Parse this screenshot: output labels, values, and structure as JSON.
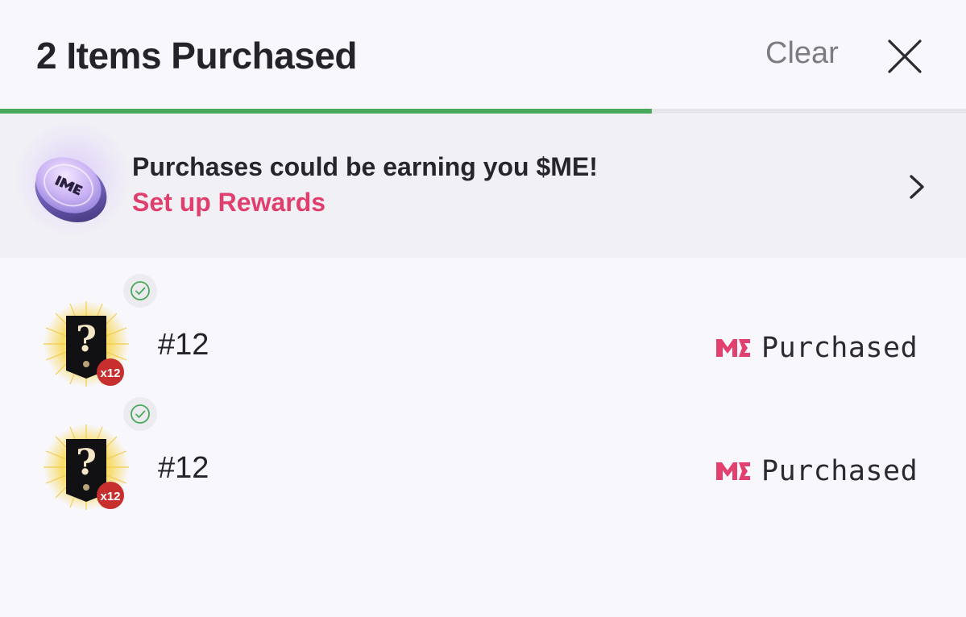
{
  "header": {
    "title": "2 Items Purchased",
    "clear_label": "Clear",
    "close_icon": "close-icon"
  },
  "progress": {
    "fraction": 0.675,
    "color": "#4aa85a"
  },
  "rewards": {
    "coin_icon": "me-coin-icon",
    "text": "Purchases could be earning you $ME!",
    "link": "Set up Rewards",
    "link_color": "#e03f6e",
    "chevron_icon": "chevron-right-icon"
  },
  "items": [
    {
      "name": "#12",
      "badge": "x12",
      "status": "Purchased",
      "check_icon": "check-circle-icon",
      "status_icon": "magic-eden-logo-icon"
    },
    {
      "name": "#12",
      "badge": "x12",
      "status": "Purchased",
      "check_icon": "check-circle-icon",
      "status_icon": "magic-eden-logo-icon"
    }
  ],
  "colors": {
    "background": "#f8f7fb",
    "banner": "#f1f0f5",
    "accent_pink": "#e03f6e",
    "success_green": "#4aa85a"
  }
}
